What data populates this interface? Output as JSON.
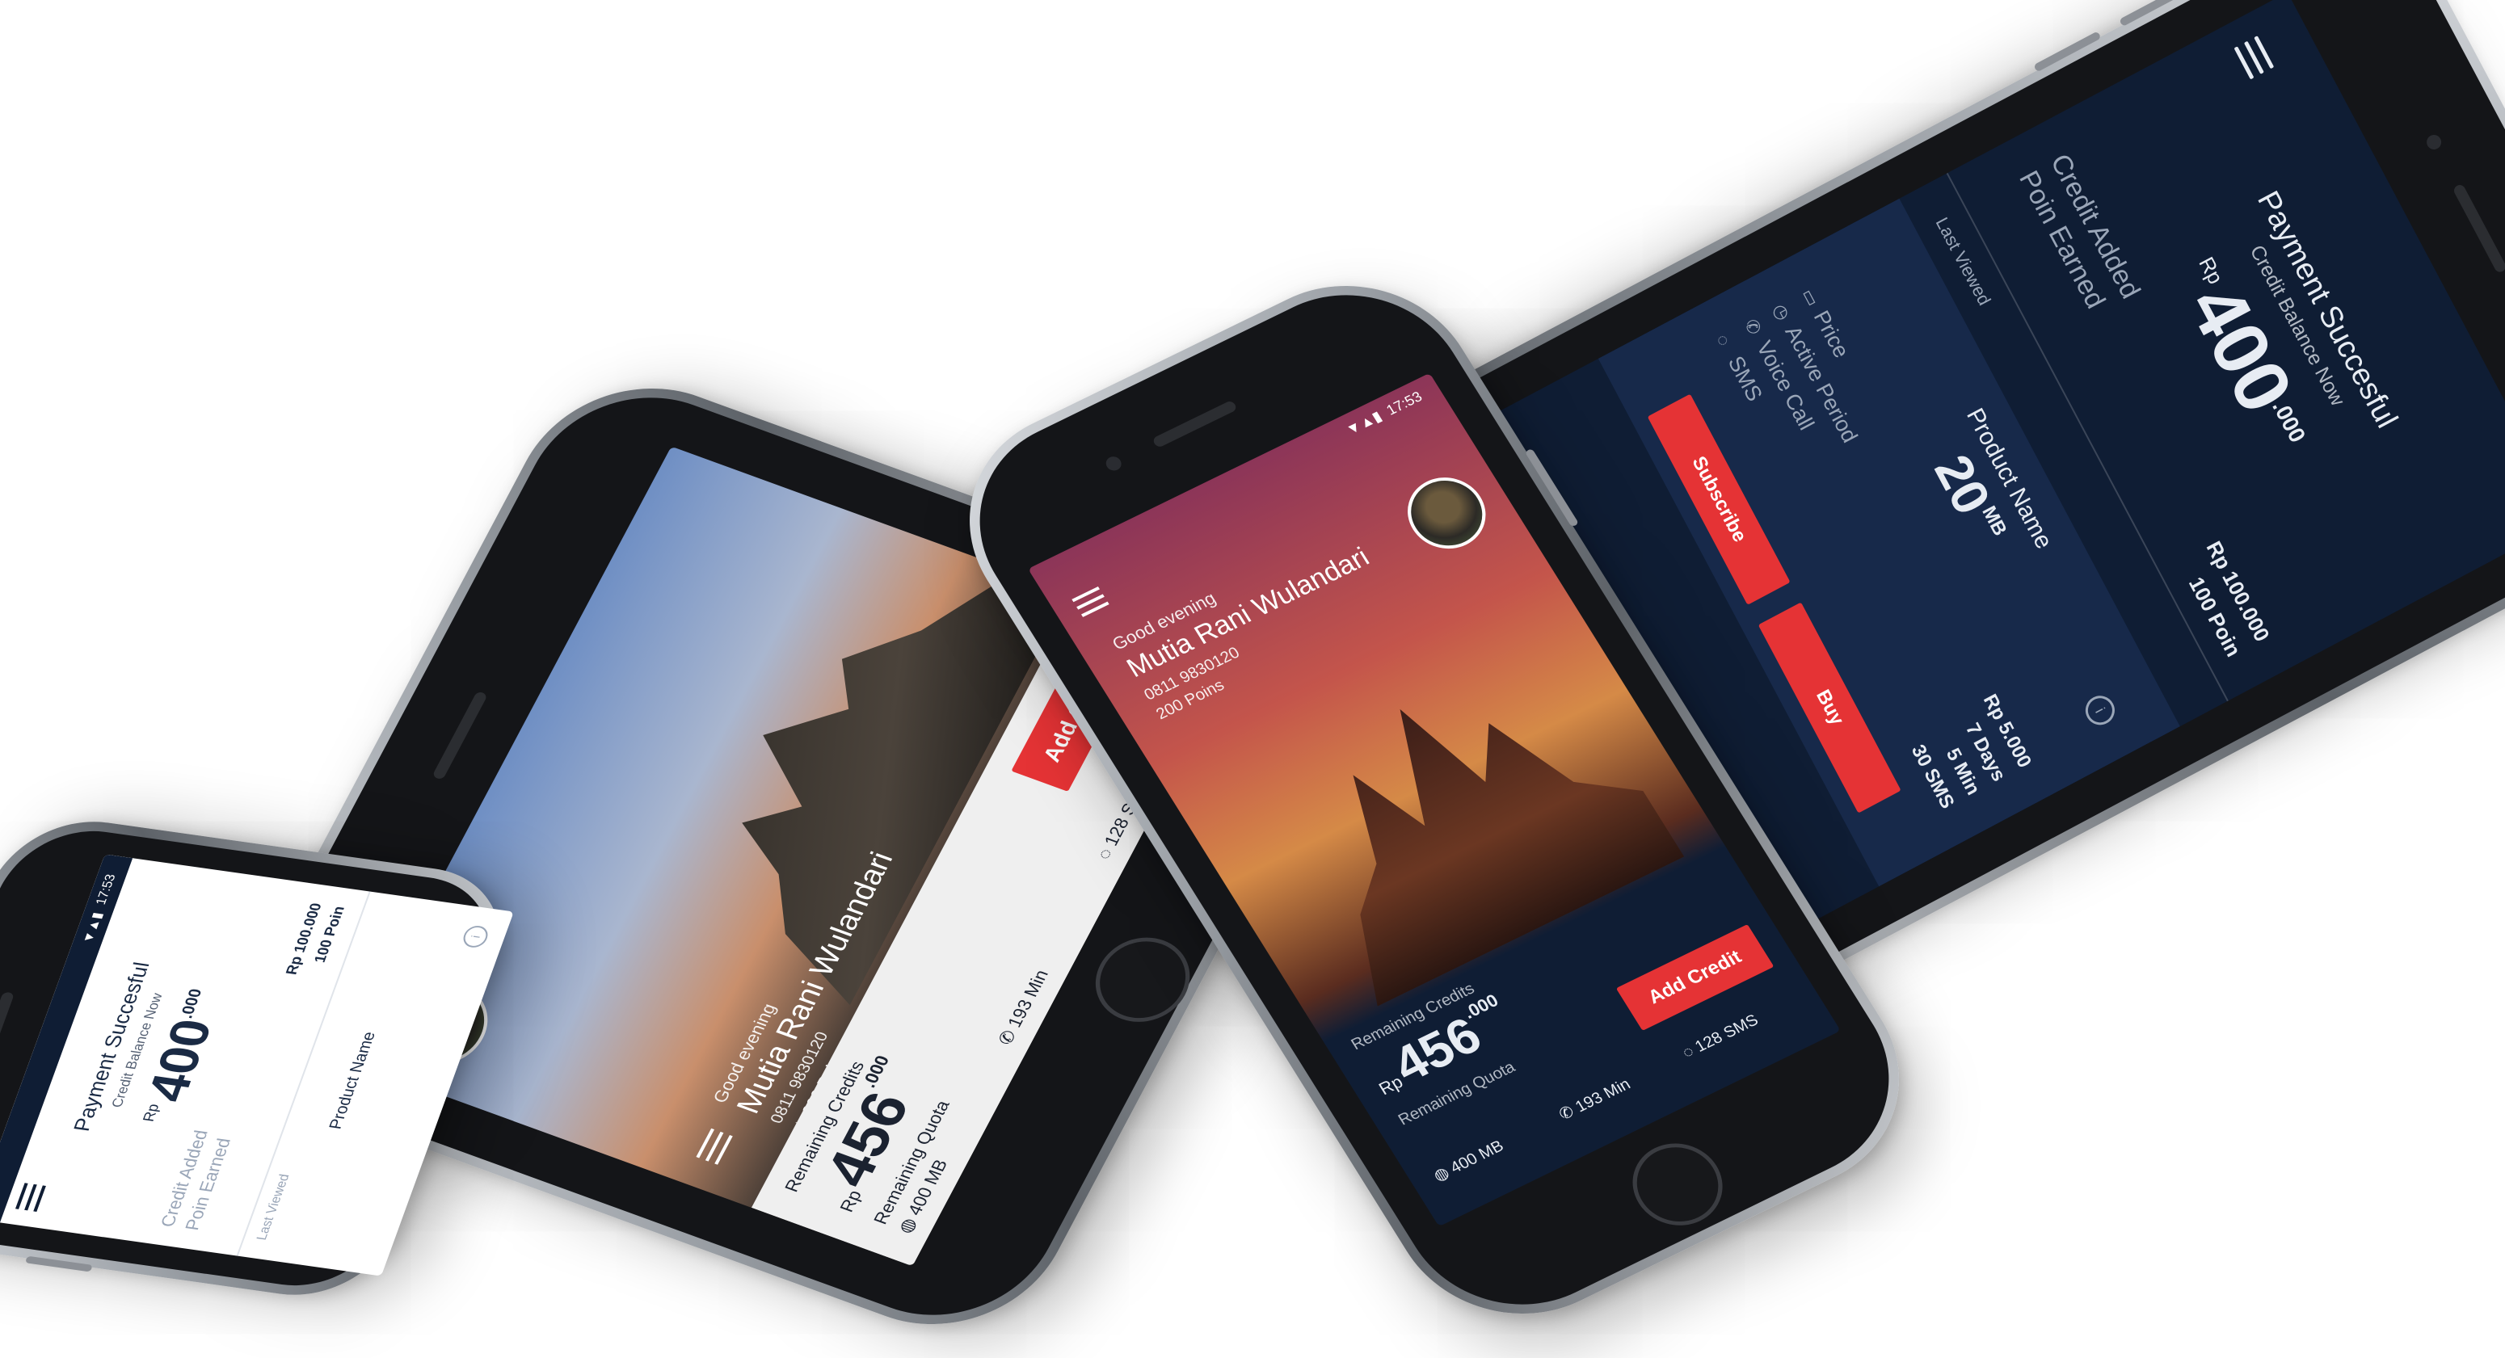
{
  "status_time": "17:53",
  "payment": {
    "title": "Payment Succesful",
    "subtitle": "Credit Balance Now",
    "currency": "Rp",
    "balance_main": "400",
    "balance_decimal": ".000",
    "credit_added_label": "Credit Added",
    "poin_earned_label": "Poin Earned",
    "credit_added_value": "Rp 100.000",
    "poin_earned_value": "100 Poin",
    "last_viewed_label": "Last Viewed"
  },
  "product": {
    "name_label": "Product Name",
    "size": "20",
    "unit": "MB",
    "info": "i",
    "price_label": "Price",
    "active_period_label": "Active Period",
    "voice_call_label": "Voice Call",
    "sms_label": "SMS",
    "price_value": "Rp 5.000",
    "active_period_value": "7 Days",
    "voice_call_value": "5 Min",
    "sms_value": "30 SMS",
    "subscribe_label": "Subscribe",
    "buy_label": "Buy"
  },
  "home": {
    "greeting": "Good evening",
    "user_name": "Mutia Rani Wulandari",
    "phone_number": "0811 9830120",
    "points": "200 Poins",
    "remaining_credits_label": "Remaining Credits",
    "currency": "Rp",
    "credit_main": "456",
    "credit_decimal": ".000",
    "add_credit_label": "Add Credit",
    "remaining_quota_label": "Remaining Quota",
    "quota_data": "400 MB",
    "quota_voice": "193 Min",
    "quota_sms": "128 SMS"
  },
  "colors": {
    "navy": "#0f1d34",
    "accent_red": "#e53335"
  }
}
